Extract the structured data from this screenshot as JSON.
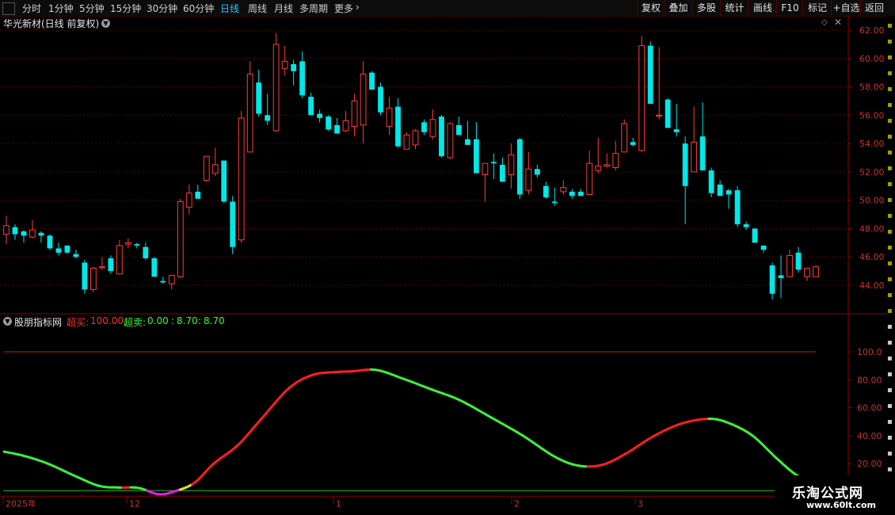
{
  "toolbar": {
    "periods": [
      "分时",
      "1分钟",
      "5分钟",
      "15分钟",
      "30分钟",
      "60分钟",
      "日线",
      "周线",
      "月线",
      "多周期",
      "更多"
    ],
    "active_period": "日线",
    "buttons": [
      "复权",
      "叠加",
      "多股",
      "统计",
      "画线",
      "F10",
      "标记",
      "+自选",
      "返回"
    ]
  },
  "main_chart": {
    "title": "华光新材(日线 前复权)",
    "price_ticks": [
      "62.00",
      "60.00",
      "58.00",
      "56.00",
      "54.00",
      "52.00",
      "50.00",
      "48.00",
      "46.00",
      "44.00"
    ],
    "up_color": "#ff3c3c",
    "down_color": "#00e8e8"
  },
  "indicator": {
    "name": "股朋指标网",
    "overbought_label": "超买:",
    "overbought_value": "100.00",
    "oversold_label": "超卖:",
    "oversold_value": "0.00",
    "value_a": "8.70",
    "value_b": "8.70",
    "ticks": [
      "100.0",
      "80.00",
      "60.00",
      "40.00",
      "20.00"
    ]
  },
  "date_axis": [
    "2025年",
    "12",
    "1",
    "2",
    "3"
  ],
  "watermark": {
    "title": "乐淘公式网",
    "url": "www.60lt.com"
  },
  "chart_data": {
    "type": "candlestick",
    "title": "华光新材(日线 前复权)",
    "ylim": [
      43,
      62.5
    ],
    "candles": [
      [
        47.6,
        48.9,
        46.9,
        48.2
      ],
      [
        48.1,
        48.3,
        47.2,
        47.6
      ],
      [
        47.8,
        47.9,
        47.0,
        47.5
      ],
      [
        47.4,
        48.6,
        47.3,
        47.9
      ],
      [
        47.7,
        47.8,
        47.0,
        47.5
      ],
      [
        47.5,
        47.6,
        46.5,
        46.6
      ],
      [
        46.6,
        47.0,
        46.1,
        46.3
      ],
      [
        46.8,
        46.8,
        46.2,
        46.3
      ],
      [
        46.2,
        46.5,
        45.9,
        46.0
      ],
      [
        45.6,
        45.8,
        43.4,
        43.7
      ],
      [
        43.7,
        45.3,
        43.5,
        45.2
      ],
      [
        45.3,
        46.0,
        45.1,
        45.3
      ],
      [
        45.9,
        46.1,
        44.8,
        45.0
      ],
      [
        44.8,
        47.2,
        44.8,
        46.8
      ],
      [
        46.9,
        47.3,
        46.6,
        47.0
      ],
      [
        46.9,
        47.0,
        46.6,
        46.8
      ],
      [
        46.7,
        47.0,
        45.8,
        45.9
      ],
      [
        45.9,
        46.0,
        44.7,
        44.6
      ],
      [
        44.3,
        44.6,
        44.1,
        44.2
      ],
      [
        44.1,
        44.7,
        43.7,
        44.7
      ],
      [
        44.6,
        50.1,
        44.5,
        49.9
      ],
      [
        49.5,
        51.1,
        49.0,
        50.5
      ],
      [
        50.6,
        51.1,
        50.2,
        50.1
      ],
      [
        51.4,
        53.0,
        51.3,
        53.1
      ],
      [
        51.9,
        53.7,
        51.7,
        52.5
      ],
      [
        52.8,
        52.6,
        49.8,
        49.9
      ],
      [
        49.9,
        50.3,
        46.2,
        46.7
      ],
      [
        47.2,
        56.3,
        47.0,
        55.8
      ],
      [
        53.4,
        59.8,
        53.4,
        58.9
      ],
      [
        58.3,
        59.2,
        55.9,
        56.1
      ],
      [
        56.0,
        57.5,
        55.3,
        55.6
      ],
      [
        54.9,
        61.8,
        54.8,
        61.0
      ],
      [
        59.3,
        60.9,
        58.8,
        59.8
      ],
      [
        59.6,
        59.9,
        58.1,
        59.1
      ],
      [
        59.8,
        60.5,
        57.2,
        57.4
      ],
      [
        57.3,
        57.6,
        56.3,
        56.0
      ],
      [
        56.1,
        56.4,
        55.5,
        55.8
      ],
      [
        55.9,
        56.0,
        54.9,
        55.0
      ],
      [
        55.3,
        55.8,
        54.9,
        54.7
      ],
      [
        54.9,
        56.3,
        54.8,
        55.6
      ],
      [
        55.2,
        57.5,
        54.5,
        57.0
      ],
      [
        55.3,
        59.8,
        54.0,
        58.9
      ],
      [
        59.0,
        59.1,
        57.8,
        57.8
      ],
      [
        58.0,
        58.3,
        56.0,
        56.2
      ],
      [
        55.2,
        57.3,
        54.6,
        56.5
      ],
      [
        56.6,
        57.2,
        53.7,
        53.8
      ],
      [
        53.6,
        54.8,
        53.6,
        54.6
      ],
      [
        53.9,
        55.0,
        53.6,
        54.9
      ],
      [
        55.5,
        55.7,
        54.6,
        54.8
      ],
      [
        54.5,
        56.4,
        54.3,
        55.7
      ],
      [
        55.9,
        56.0,
        53.0,
        53.1
      ],
      [
        53.0,
        55.5,
        52.9,
        55.4
      ],
      [
        55.3,
        55.9,
        54.6,
        54.6
      ],
      [
        54.3,
        55.6,
        54.2,
        53.9
      ],
      [
        54.3,
        55.5,
        52.0,
        51.9
      ],
      [
        51.8,
        52.4,
        49.9,
        52.6
      ],
      [
        52.7,
        53.3,
        51.5,
        52.6
      ],
      [
        52.5,
        53.0,
        51.6,
        51.3
      ],
      [
        51.8,
        54.0,
        50.8,
        53.2
      ],
      [
        54.3,
        54.4,
        50.1,
        50.4
      ],
      [
        50.7,
        53.4,
        50.4,
        52.2
      ],
      [
        52.2,
        52.5,
        51.6,
        51.8
      ],
      [
        51.0,
        51.3,
        50.1,
        50.2
      ],
      [
        49.9,
        50.9,
        49.6,
        49.8
      ],
      [
        50.6,
        51.4,
        50.4,
        50.9
      ],
      [
        50.6,
        50.8,
        50.1,
        50.3
      ],
      [
        50.6,
        50.8,
        50.3,
        50.3
      ],
      [
        50.4,
        53.5,
        50.4,
        52.6
      ],
      [
        52.1,
        54.4,
        51.9,
        52.4
      ],
      [
        52.4,
        53.3,
        52.3,
        52.5
      ],
      [
        52.3,
        54.2,
        52.1,
        53.3
      ],
      [
        53.4,
        55.7,
        53.4,
        55.4
      ],
      [
        54.1,
        54.4,
        53.8,
        53.9
      ],
      [
        53.5,
        61.6,
        53.4,
        60.9
      ],
      [
        60.9,
        61.2,
        56.8,
        56.8
      ],
      [
        56.0,
        60.8,
        55.7,
        56.0
      ],
      [
        57.1,
        57.2,
        55.8,
        55.1
      ],
      [
        55.0,
        56.8,
        54.5,
        54.8
      ],
      [
        54.0,
        54.5,
        48.3,
        51.0
      ],
      [
        52.0,
        56.6,
        52.0,
        54.1
      ],
      [
        54.5,
        56.9,
        54.0,
        52.1
      ],
      [
        52.1,
        52.3,
        50.2,
        50.5
      ],
      [
        51.1,
        51.4,
        50.7,
        50.3
      ],
      [
        50.7,
        50.8,
        49.4,
        50.4
      ],
      [
        50.7,
        51.0,
        48.1,
        48.3
      ],
      [
        48.3,
        48.5,
        47.9,
        48.1
      ],
      [
        48.0,
        48.0,
        47.0,
        47.0
      ],
      [
        46.8,
        46.8,
        46.3,
        46.5
      ],
      [
        45.4,
        45.6,
        43.0,
        43.4
      ],
      [
        44.7,
        46.1,
        43.1,
        44.5
      ],
      [
        44.6,
        46.5,
        44.6,
        46.1
      ],
      [
        46.3,
        46.7,
        44.9,
        45.1
      ],
      [
        44.6,
        45.1,
        44.3,
        45.2
      ],
      [
        44.6,
        45.4,
        44.7,
        45.3
      ]
    ]
  }
}
